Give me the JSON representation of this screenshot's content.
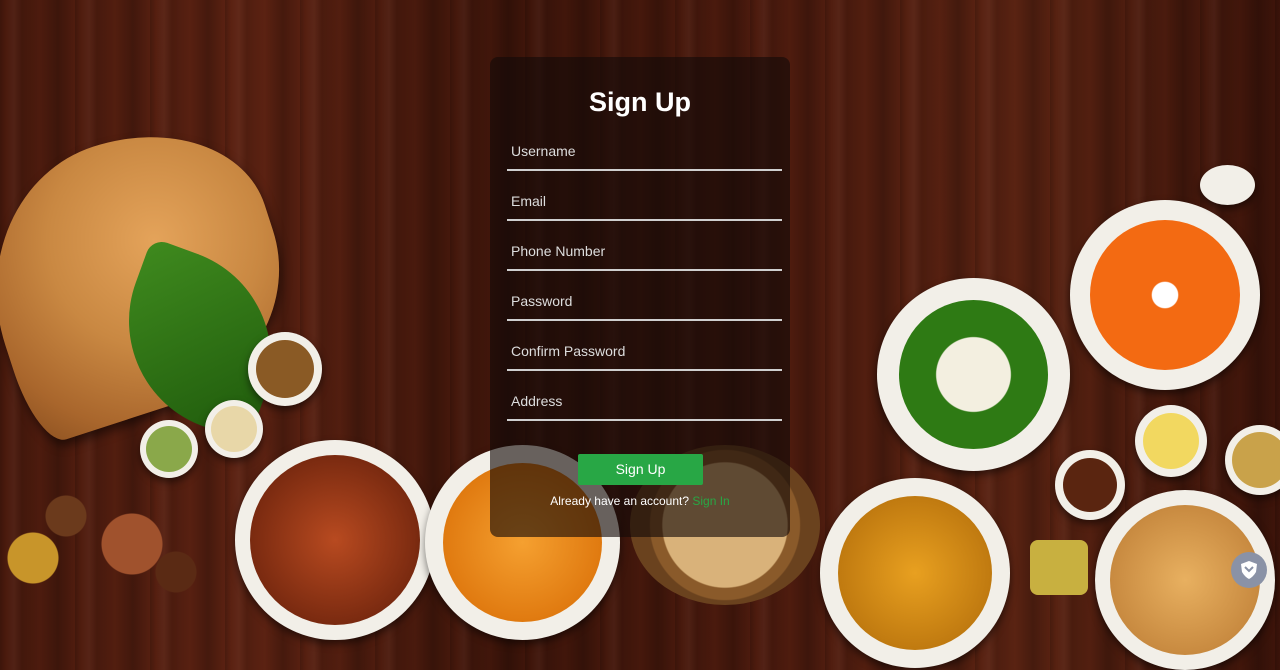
{
  "form": {
    "title": "Sign Up",
    "fields": [
      {
        "placeholder": "Username"
      },
      {
        "placeholder": "Email"
      },
      {
        "placeholder": "Phone Number"
      },
      {
        "placeholder": "Password"
      },
      {
        "placeholder": "Confirm Password"
      },
      {
        "placeholder": "Address"
      }
    ],
    "submit_label": "Sign Up",
    "footer_text": "Already have an account?",
    "signin_link": "Sign In"
  },
  "colors": {
    "accent": "#28a745",
    "background": "#4a1a0d",
    "card": "#140a08"
  },
  "widget": {
    "icon": "shield-icon"
  }
}
